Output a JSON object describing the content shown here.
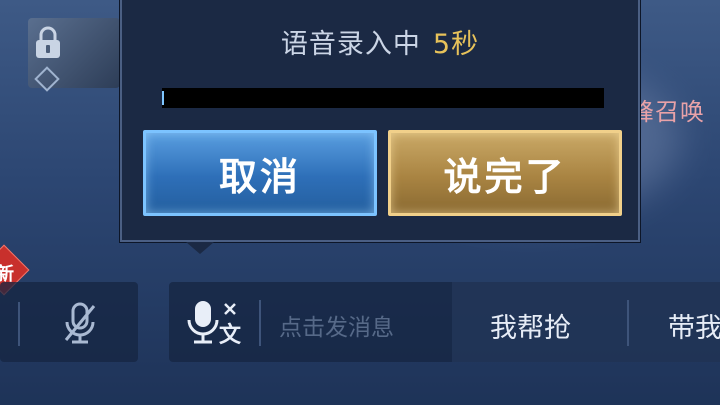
{
  "recording_dialog": {
    "title": "语音录入中",
    "seconds_label": "5秒",
    "progress_fraction": 0.004,
    "cancel_label": "取消",
    "done_label": "说完了"
  },
  "background": {
    "peek_text": "巅峰召唤",
    "new_badge": "新"
  },
  "chat_bar": {
    "input_placeholder": "点击发消息",
    "quick_buttons": [
      "我帮抢",
      "带我"
    ]
  },
  "colors": {
    "dialog_bg": "#1b2944",
    "seconds_accent": "#e7c25a",
    "cancel_blue": "#2e6fb8",
    "done_gold": "#a98442",
    "progress_fill": "#7fc6ff"
  },
  "icons": {
    "lock": "lock-icon",
    "mic_muted": "mic-muted-icon",
    "voice_to_text": "voice-to-text-icon"
  }
}
